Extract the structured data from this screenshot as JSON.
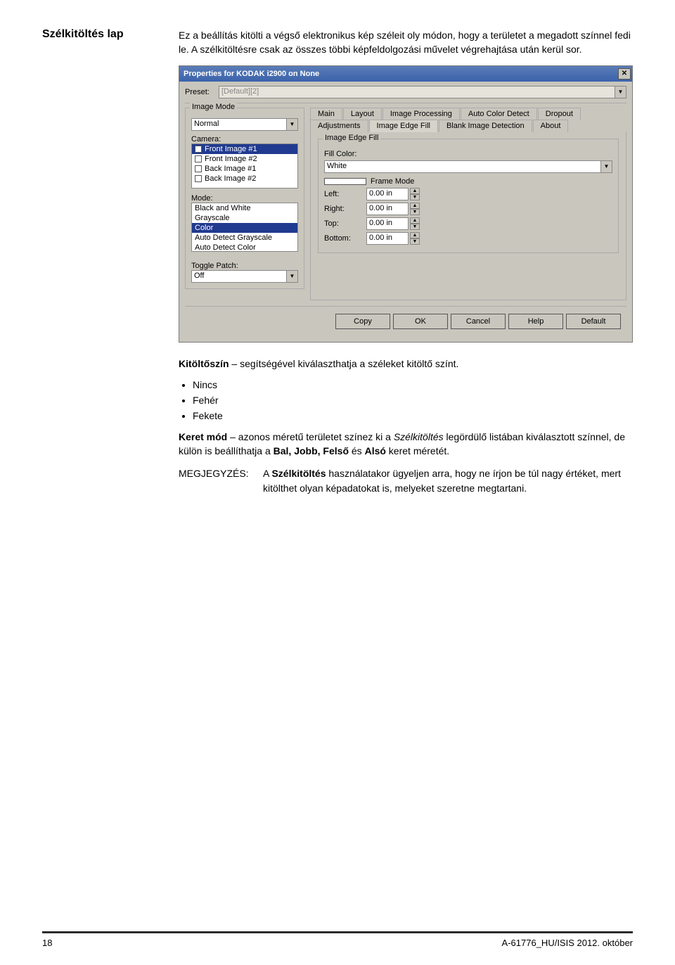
{
  "section_title": "Szélkitöltés lap",
  "intro_text": "Ez a beállítás kitölti a végső elektronikus kép széleit oly módon, hogy a területet a megadott színnel fedi le. A szélkitöltésre csak az összes többi képfeldolgozási művelet végrehajtása után kerül sor.",
  "dialog": {
    "title": "Properties for KODAK i2900 on None",
    "preset_label": "Preset:",
    "preset_value": "[Default][2]",
    "left": {
      "image_mode_label": "Image Mode",
      "image_mode_value": "Normal",
      "camera_label": "Camera:",
      "camera_items": [
        {
          "label": "Front Image #1",
          "checked": true,
          "selected": true
        },
        {
          "label": "Front Image #2",
          "checked": false,
          "selected": false
        },
        {
          "label": "Back Image #1",
          "checked": false,
          "selected": false
        },
        {
          "label": "Back Image #2",
          "checked": false,
          "selected": false
        }
      ],
      "mode_label": "Mode:",
      "mode_items": [
        {
          "label": "Black and White",
          "selected": false
        },
        {
          "label": "Grayscale",
          "selected": false
        },
        {
          "label": "Color",
          "selected": true
        },
        {
          "label": "Auto Detect Grayscale",
          "selected": false
        },
        {
          "label": "Auto Detect Color",
          "selected": false
        }
      ],
      "toggle_patch_label": "Toggle Patch:",
      "toggle_patch_value": "Off"
    },
    "tabs_row1": [
      "Main",
      "Layout",
      "Image Processing",
      "Auto Color Detect",
      "Dropout"
    ],
    "tabs_row2": [
      "Adjustments",
      "Image Edge Fill",
      "Blank Image Detection",
      "About"
    ],
    "active_tab": "Image Edge Fill",
    "edge_fill": {
      "group_title": "Image Edge Fill",
      "fill_color_label": "Fill Color:",
      "fill_color_value": "White",
      "frame_mode_label": "Frame Mode",
      "fields": [
        {
          "label": "Left:",
          "value": "0.00 in"
        },
        {
          "label": "Right:",
          "value": "0.00 in"
        },
        {
          "label": "Top:",
          "value": "0.00 in"
        },
        {
          "label": "Bottom:",
          "value": "0.00 in"
        }
      ]
    },
    "buttons": [
      "Copy",
      "OK",
      "Cancel",
      "Help",
      "Default"
    ]
  },
  "below": {
    "fillcolor_bold": "Kitöltőszín",
    "fillcolor_rest": " – segítségével kiválaszthatja a széleket kitöltő színt.",
    "bullets": [
      "Nincs",
      "Fehér",
      "Fekete"
    ],
    "frame_bold": "Keret mód",
    "frame_rest_1": " – azonos méretű területet színez ki a ",
    "frame_italic": "Szélkitöltés",
    "frame_rest_2": " legördülő listában kiválasztott színnel, de külön is beállíthatja a ",
    "frame_bold2": "Bal, Jobb, Felső",
    "frame_rest_3": " és ",
    "frame_bold3": "Alsó",
    "frame_rest_4": " keret méretét.",
    "note_label": "MEGJEGYZÉS: ",
    "note_text_1": "A ",
    "note_bold": "Szélkitöltés",
    "note_text_2": " használatakor ügyeljen arra, hogy ne írjon be túl nagy értéket, mert kitölthet olyan képadatokat is, melyeket szeretne megtartani."
  },
  "footer": {
    "page": "18",
    "doc": "A-61776_HU/ISIS 2012. október"
  }
}
